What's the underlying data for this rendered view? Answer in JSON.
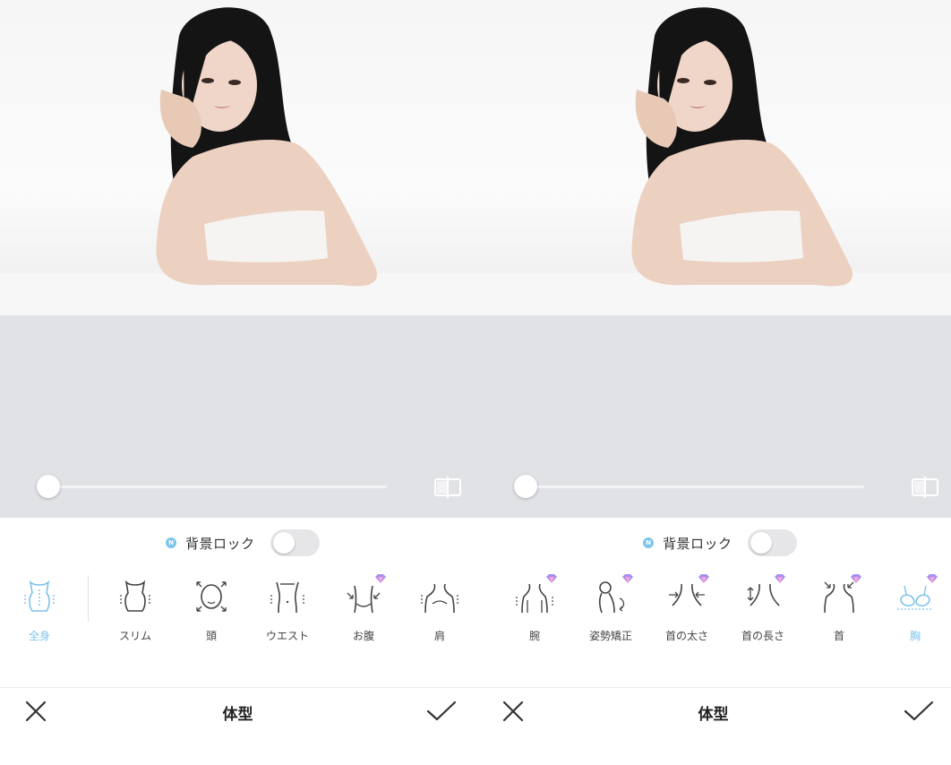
{
  "screens": [
    {
      "bg_lock": {
        "new_badge": "N",
        "label": "背景ロック",
        "enabled": false
      },
      "slider": {
        "value": 0
      },
      "tools": [
        {
          "label": "全身",
          "icon": "full-body-icon",
          "premium": false,
          "active": true
        },
        {
          "label": "スリム",
          "icon": "slim-torso-icon",
          "premium": false,
          "active": false
        },
        {
          "label": "頭",
          "icon": "head-icon",
          "premium": false,
          "active": false
        },
        {
          "label": "ウエスト",
          "icon": "waist-icon",
          "premium": false,
          "active": false
        },
        {
          "label": "お腹",
          "icon": "belly-icon",
          "premium": true,
          "active": false
        },
        {
          "label": "肩",
          "icon": "shoulder-icon",
          "premium": false,
          "active": false
        }
      ],
      "bottom_bar": {
        "title": "体型"
      }
    },
    {
      "bg_lock": {
        "new_badge": "N",
        "label": "背景ロック",
        "enabled": false
      },
      "slider": {
        "value": 0
      },
      "tools": [
        {
          "label": "腕",
          "icon": "arm-icon",
          "premium": true,
          "active": false
        },
        {
          "label": "姿勢矯正",
          "icon": "posture-icon",
          "premium": true,
          "active": false
        },
        {
          "label": "首の太さ",
          "icon": "neck-width-icon",
          "premium": true,
          "active": false
        },
        {
          "label": "首の長さ",
          "icon": "neck-length-icon",
          "premium": true,
          "active": false
        },
        {
          "label": "首",
          "icon": "neck-icon",
          "premium": true,
          "active": false
        },
        {
          "label": "胸",
          "icon": "chest-icon",
          "premium": true,
          "active": true
        }
      ],
      "bottom_bar": {
        "title": "体型"
      }
    }
  ],
  "colors": {
    "accent": "#7ec3ea",
    "canvas_gray": "#e1e2e6",
    "premium_gem": "#a88cf0"
  }
}
